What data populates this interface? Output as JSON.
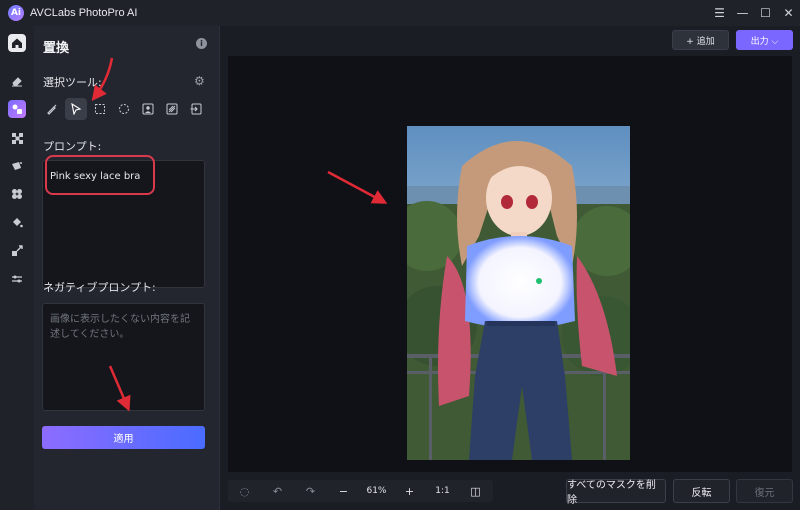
{
  "app": {
    "title": "AVCLabs PhotoPro AI",
    "logo_text": "Ai"
  },
  "window_controls": [
    "☰",
    "—",
    "☐",
    "✕"
  ],
  "sidebar_rail": {
    "items": [
      "home-icon",
      "eraser-icon",
      "replace-icon",
      "grid-icon",
      "paint-icon",
      "fan-icon",
      "bucket-icon",
      "resize-icon",
      "sliders-icon"
    ]
  },
  "panel": {
    "title": "置換",
    "selection_tool_label": "選択ツール:",
    "prompt_label": "プロンプト:",
    "prompt_value": "Pink sexy lace bra",
    "negative_label": "ネガティブプロンプト:",
    "negative_placeholder": "画像に表示したくない内容を記述してください。",
    "apply_label": "適用"
  },
  "topbar": {
    "add_label": "+ 追加",
    "export_label": "出力 ⌵"
  },
  "bottombar": {
    "zoom_out": "−",
    "zoom": "61%",
    "zoom_in": "+",
    "ratio": "1:1",
    "remove_all_masks": "すべてのマスクを削除",
    "invert": "反転",
    "restore": "復元"
  },
  "colors": {
    "accent": "#7a67ff",
    "annotation": "#d9394c",
    "apply_from": "#8d6cff",
    "apply_to": "#4a6cff"
  }
}
